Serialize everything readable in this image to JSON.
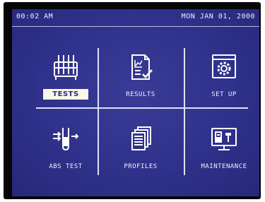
{
  "status": {
    "time": "00:02 AM",
    "date": "MON JAN 01, 2000"
  },
  "menu": {
    "selected": "tests",
    "tiles": [
      {
        "id": "tests",
        "label": "TESTS",
        "icon": "test-tube-rack-icon"
      },
      {
        "id": "results",
        "label": "RESULTS",
        "icon": "results-chart-icon"
      },
      {
        "id": "setup",
        "label": "SET UP",
        "icon": "settings-gear-icon"
      },
      {
        "id": "abs-test",
        "label": "ABS TEST",
        "icon": "abs-test-tube-icon"
      },
      {
        "id": "profiles",
        "label": "PROFILES",
        "icon": "profiles-documents-icon"
      },
      {
        "id": "maintenance",
        "label": "MAINTENANCE",
        "icon": "maintenance-monitor-icon"
      }
    ]
  },
  "colors": {
    "screen": "#2f318a",
    "text": "#eef0ff",
    "selected_bg": "#fbf7e8",
    "selected_text": "#2b2d85"
  }
}
